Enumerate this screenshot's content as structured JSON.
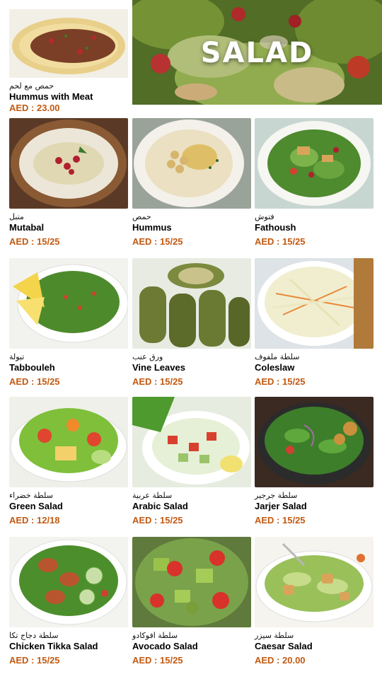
{
  "hero": {
    "title": "SALAD"
  },
  "items": [
    {
      "ar": "حمص مع لحم",
      "en": "Hummus with Meat",
      "price": "AED : 23.00"
    },
    {
      "ar": "متبل",
      "en": "Mutabal",
      "price": "AED : 15/25"
    },
    {
      "ar": "حمص",
      "en": "Hummus",
      "price": "AED : 15/25"
    },
    {
      "ar": "فتوش",
      "en": "Fathoush",
      "price": "AED : 15/25"
    },
    {
      "ar": "تبولة",
      "en": "Tabbouleh",
      "price": "AED : 15/25"
    },
    {
      "ar": "ورق عنب",
      "en": "Vine Leaves",
      "price": "AED : 15/25"
    },
    {
      "ar": "سلطة ملفوف",
      "en": "Coleslaw",
      "price": "AED : 15/25"
    },
    {
      "ar": "سلطة خضراء",
      "en": "Green Salad",
      "price": "AED : 12/18"
    },
    {
      "ar": "سلطة عربية",
      "en": "Arabic Salad",
      "price": "AED : 15/25"
    },
    {
      "ar": "سلطة جرجير",
      "en": "Jarjer Salad",
      "price": "AED : 15/25"
    },
    {
      "ar": "سلطة دجاج تكا",
      "en": "Chicken Tikka Salad",
      "price": "AED : 15/25"
    },
    {
      "ar": "سلطة افوكادو",
      "en": "Avocado Salad",
      "price": "AED : 15/25"
    },
    {
      "ar": "سلطة سيزر",
      "en": "Caesar Salad",
      "price": "AED : 20.00"
    }
  ],
  "colors": {
    "price": "#c25a12",
    "background": "#ffffff"
  }
}
